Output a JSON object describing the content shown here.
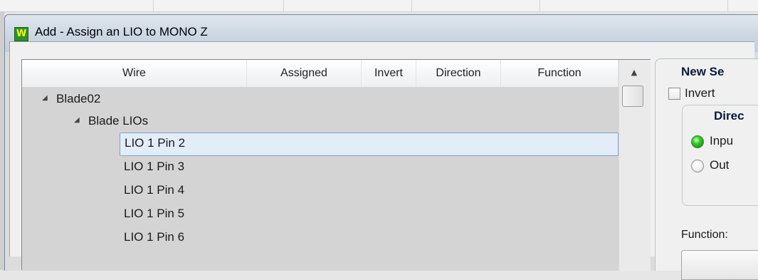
{
  "dialog": {
    "title": "Add - Assign an LIO to MONO Z",
    "icon": "app-w-icon",
    "icon_glyph": "W"
  },
  "grid": {
    "columns": [
      "Wire",
      "Assigned",
      "Invert",
      "Direction",
      "Function"
    ],
    "rows": [
      {
        "label": "Blade02",
        "level": 0,
        "expanded": true
      },
      {
        "label": "Blade LIOs",
        "level": 1,
        "expanded": true
      },
      {
        "label": "LIO 1 Pin 2",
        "level": 2,
        "selected": true
      },
      {
        "label": "LIO 1 Pin 3",
        "level": 2
      },
      {
        "label": "LIO 1 Pin 4",
        "level": 2
      },
      {
        "label": "LIO 1 Pin 5",
        "level": 2
      },
      {
        "label": "LIO 1 Pin 6",
        "level": 2
      }
    ]
  },
  "panel": {
    "title": "New Se",
    "invert_label": "Invert",
    "invert_checked": false,
    "direction": {
      "title": "Direc",
      "options": [
        {
          "label": "Inpu",
          "checked": true
        },
        {
          "label": "Out",
          "checked": false
        }
      ]
    },
    "function_label": "Function:"
  },
  "colors": {
    "accent_green": "#31d322",
    "selection_bg": "#e3edf7",
    "title_text": "#0b1a3b"
  }
}
